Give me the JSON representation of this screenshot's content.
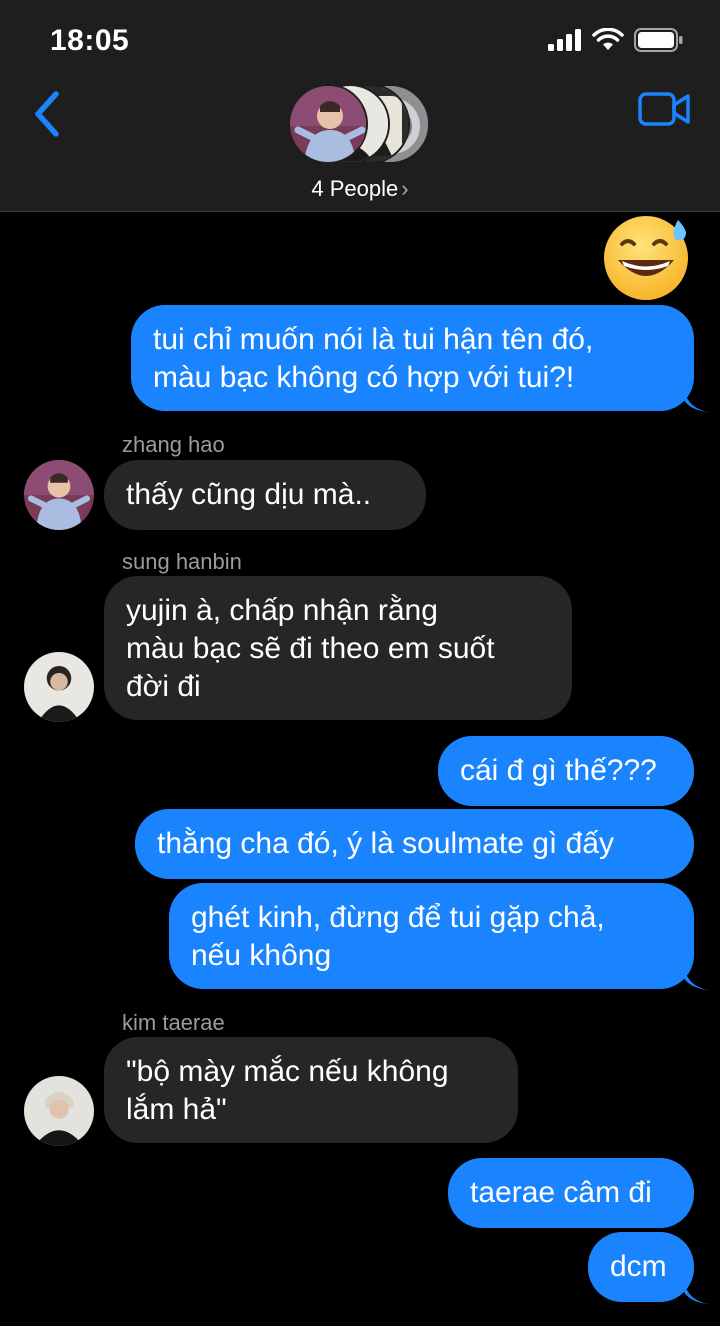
{
  "status_bar": {
    "time": "18:05"
  },
  "header": {
    "group_label": "4 People",
    "chevron": "›"
  },
  "messages": [
    {
      "from": "me",
      "lines": [
        "tui chỉ muốn nói là tui hận tên đó,",
        "màu bạc không có hợp với tui?!"
      ]
    },
    {
      "sender": "zhang hao",
      "text": "thấy cũng dịu mà.."
    },
    {
      "sender": "sung hanbin",
      "lines": [
        "yujin à, chấp nhận rằng",
        "màu bạc sẽ đi theo em suốt",
        "đời đi"
      ]
    },
    {
      "from": "me",
      "text": "cái đ gì thế???"
    },
    {
      "from": "me",
      "text": "thằng cha đó, ý là soulmate gì đấy"
    },
    {
      "from": "me",
      "lines": [
        "ghét kinh, đừng để tui gặp chả,",
        "nếu không"
      ]
    },
    {
      "sender": "kim taerae",
      "lines": [
        "\"bộ mày mắc nếu không",
        "lắm hả\""
      ]
    },
    {
      "from": "me",
      "text": "taerae câm đi"
    },
    {
      "from": "me",
      "text": "dcm"
    }
  ],
  "colors": {
    "sent_bubble": "#1a84ff",
    "received_bubble": "#262628",
    "accent": "#1a84ff"
  },
  "icons": [
    "back-chevron-icon",
    "video-camera-icon",
    "signal-icon",
    "wifi-icon",
    "battery-icon",
    "sweat-smile-emoji"
  ]
}
